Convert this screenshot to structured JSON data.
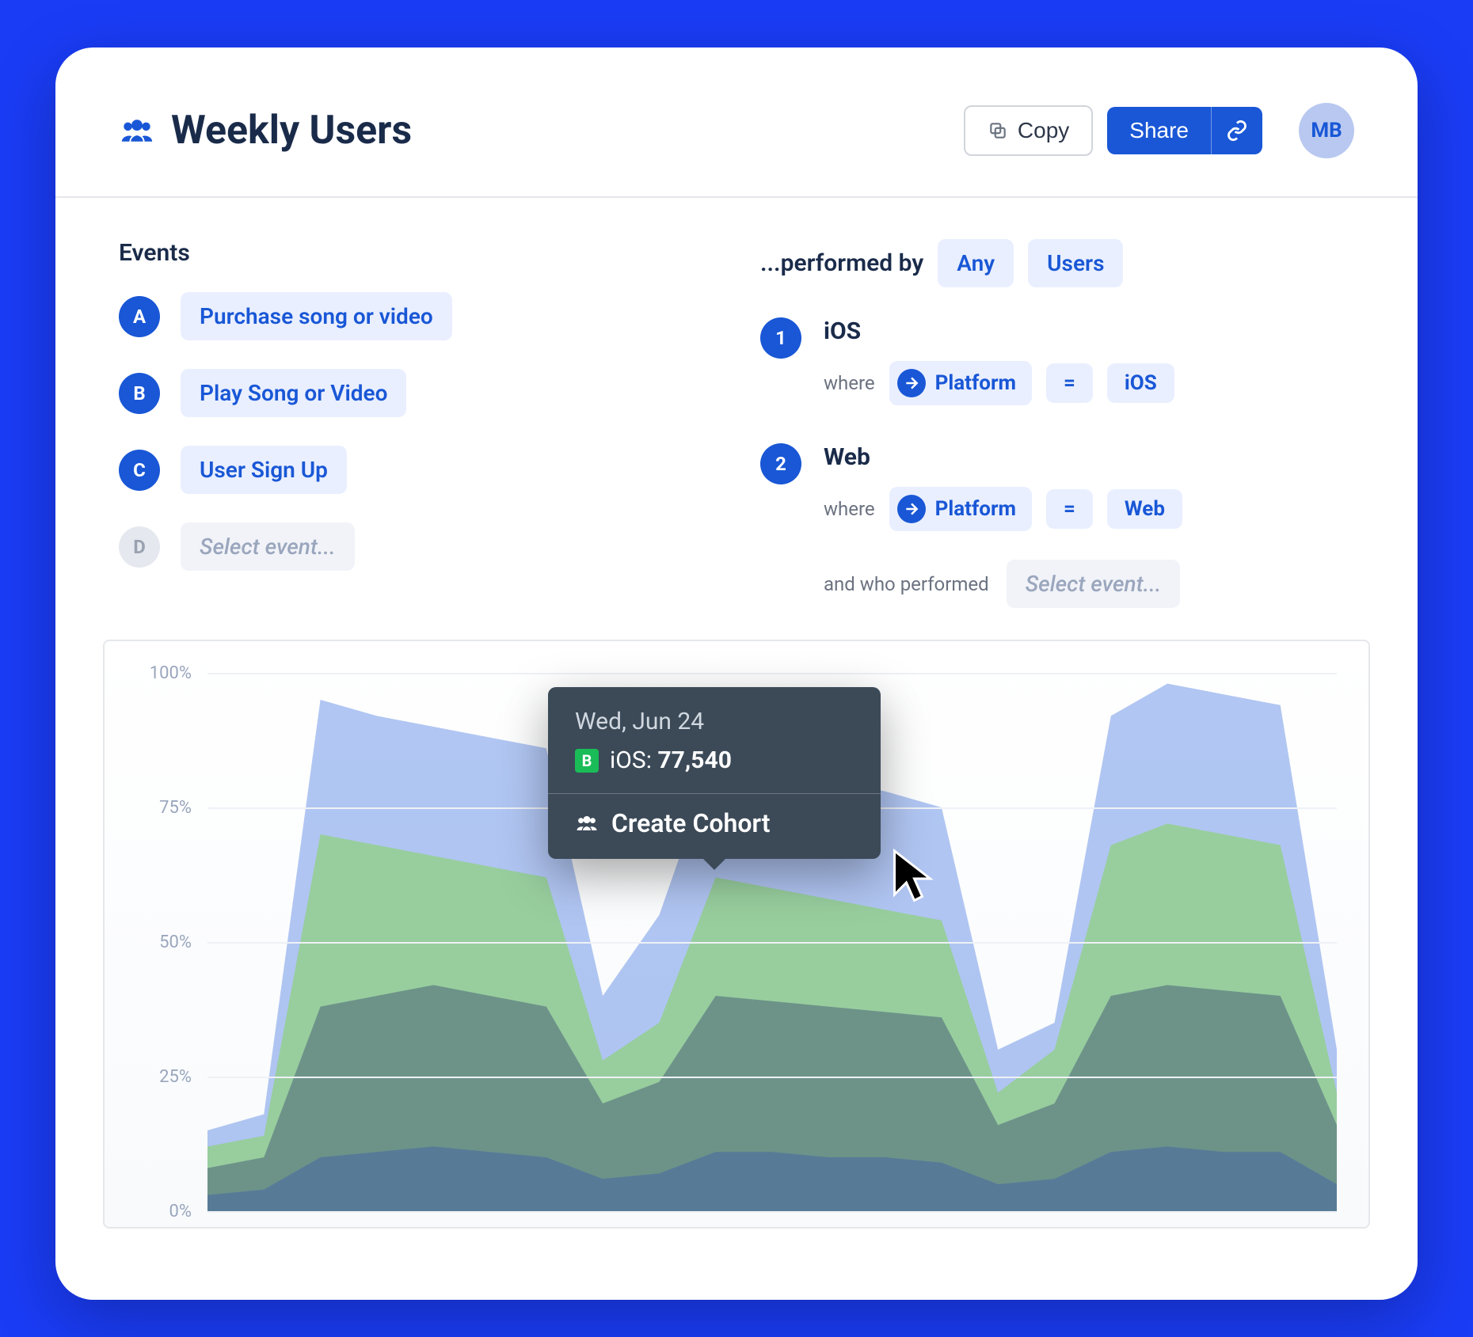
{
  "header": {
    "title": "Weekly Users",
    "copy_label": "Copy",
    "share_label": "Share",
    "avatar_initials": "MB"
  },
  "events": {
    "section_label": "Events",
    "items": [
      {
        "letter": "A",
        "label": "Purchase song or video",
        "placeholder": false
      },
      {
        "letter": "B",
        "label": "Play Song or Video",
        "placeholder": false
      },
      {
        "letter": "C",
        "label": "User Sign Up",
        "placeholder": false
      },
      {
        "letter": "D",
        "label": "Select event...",
        "placeholder": true
      }
    ]
  },
  "performed_by": {
    "label": "...performed by",
    "any_chip": "Any",
    "users_chip": "Users",
    "segments": [
      {
        "num": "1",
        "name": "iOS",
        "where": "where",
        "property": "Platform",
        "op": "=",
        "value": "iOS"
      },
      {
        "num": "2",
        "name": "Web",
        "where": "where",
        "property": "Platform",
        "op": "=",
        "value": "Web"
      }
    ],
    "and_label": "and who performed",
    "and_placeholder": "Select event..."
  },
  "tooltip": {
    "date": "Wed, Jun 24",
    "series_letter": "B",
    "series_name": "iOS",
    "value": "77,540",
    "action": "Create Cohort"
  },
  "chart_data": {
    "type": "area",
    "ylabel": "",
    "xlabel": "",
    "ylim": [
      0,
      100
    ],
    "y_ticks": [
      "100%",
      "75%",
      "50%",
      "25%",
      "0%"
    ],
    "x": [
      0,
      1,
      2,
      3,
      4,
      5,
      6,
      7,
      8,
      9,
      10,
      11,
      12,
      13,
      14,
      15,
      16,
      17,
      18,
      19,
      20
    ],
    "series": [
      {
        "name": "A",
        "color": "#7197e8",
        "values": [
          15,
          18,
          95,
          92,
          90,
          88,
          86,
          40,
          55,
          85,
          82,
          80,
          78,
          75,
          30,
          35,
          92,
          98,
          96,
          94,
          30
        ],
        "opacity": 0.55
      },
      {
        "name": "B",
        "color": "#8fd17a",
        "values": [
          12,
          14,
          70,
          68,
          66,
          64,
          62,
          28,
          35,
          62,
          60,
          58,
          56,
          54,
          22,
          30,
          68,
          72,
          70,
          68,
          22
        ],
        "opacity": 0.7
      },
      {
        "name": "C",
        "color": "#5b7a80",
        "values": [
          8,
          10,
          38,
          40,
          42,
          40,
          38,
          20,
          24,
          40,
          39,
          38,
          37,
          36,
          16,
          20,
          40,
          42,
          41,
          40,
          16
        ],
        "opacity": 0.7
      },
      {
        "name": "D",
        "color": "#4a6aa0",
        "values": [
          3,
          4,
          10,
          11,
          12,
          11,
          10,
          6,
          7,
          11,
          11,
          10,
          10,
          9,
          5,
          6,
          11,
          12,
          11,
          11,
          5
        ],
        "opacity": 0.6
      }
    ]
  }
}
